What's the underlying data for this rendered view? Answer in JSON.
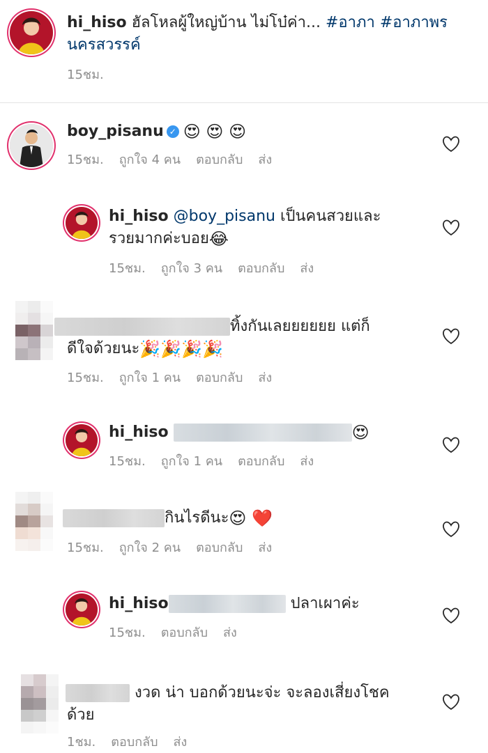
{
  "caption": {
    "username": "hi_hiso",
    "text": "ฮัลโหลผู้ใหญ่บ้าน ไม่โบ๋ค่า...",
    "tag1": "#อาภา",
    "tag2": "#อาภาพร",
    "tag2_cont": "นครสวรรค์",
    "time": "15ชม."
  },
  "comments": [
    {
      "username": "boy_pisanu",
      "text": "",
      "emoji": "😍 😍 😍",
      "time": "15ชม.",
      "likes": "ถูกใจ 4 คน",
      "reply": "ตอบกลับ",
      "send": "ส่ง"
    },
    {
      "username": "hi_hiso",
      "mention": "@boy_pisanu",
      "text": "เป็นคนสวยและ",
      "text2": "รวยมากค่ะบอย",
      "emoji": "😂",
      "time": "15ชม.",
      "likes": "ถูกใจ 3 คน",
      "reply": "ตอบกลับ",
      "send": "ส่ง"
    },
    {
      "text": "ทิ้งกันเลยยยยยย แต่ก็",
      "text2": "ดีใจด้วยนะ",
      "emoji": "🎉🎉🎉🎉",
      "time": "15ชม.",
      "likes": "ถูกใจ 1 คน",
      "reply": "ตอบกลับ",
      "send": "ส่ง"
    },
    {
      "username": "hi_hiso",
      "emoji": "😍",
      "time": "15ชม.",
      "likes": "ถูกใจ 1 คน",
      "reply": "ตอบกลับ",
      "send": "ส่ง"
    },
    {
      "text": "กินไรดีนะ",
      "emoji": "😍 ❤️",
      "time": "15ชม.",
      "likes": "ถูกใจ 2 คน",
      "reply": "ตอบกลับ",
      "send": "ส่ง"
    },
    {
      "username": "hi_hiso",
      "text": "ปลาเผาค่ะ",
      "time": "15ชม.",
      "reply": "ตอบกลับ",
      "send": "ส่ง"
    },
    {
      "text": "งวด น่า บอกด้วยนะจ่ะ จะลองเสี่ยงโชค",
      "text2": "ด้วย",
      "time": "1ชม.",
      "reply": "ตอบกลับ",
      "send": "ส่ง"
    }
  ],
  "colors": {
    "link": "#00376b",
    "meta": "#8e8e8e",
    "verified": "#3897f0"
  }
}
